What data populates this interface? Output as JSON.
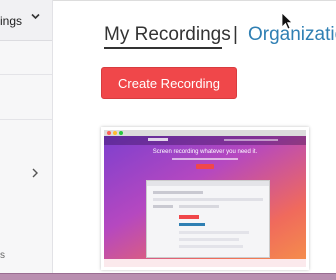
{
  "sidebar": {
    "section_label": "ings",
    "footer_char": "s"
  },
  "header": {
    "tab_my": "My Recordings",
    "separator": "|",
    "tab_org": "Organizatio"
  },
  "actions": {
    "create_label": "Create Recording"
  },
  "recording": {
    "thumbnail_headline": "Screen recording whatever you need it."
  },
  "colors": {
    "accent_red": "#f0474a",
    "link_blue": "#2f7fb3"
  },
  "icons": {
    "sidebar_section": "chevron-down-icon",
    "sidebar_row": "chevron-right-icon",
    "pointer": "cursor-icon"
  }
}
